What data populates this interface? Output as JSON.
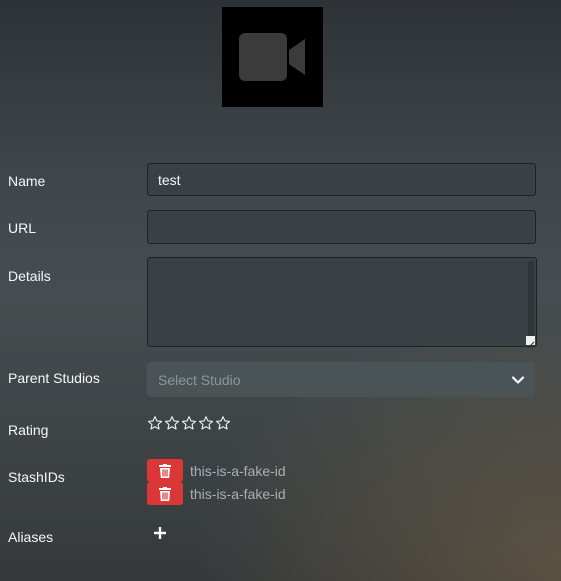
{
  "studio_image": {
    "icon": "video-camera-icon",
    "background": "#000000"
  },
  "form": {
    "name": {
      "label": "Name",
      "value": "test"
    },
    "url": {
      "label": "URL",
      "value": ""
    },
    "details": {
      "label": "Details",
      "value": ""
    },
    "parent_studios": {
      "label": "Parent Studios",
      "placeholder": "Select Studio",
      "icon": "chevron-down-icon"
    },
    "rating": {
      "label": "Rating",
      "value": 0,
      "max": 5,
      "icon": "star-outline-icon"
    },
    "stash_ids": {
      "label": "StashIDs",
      "items": [
        "this-is-a-fake-id",
        "this-is-a-fake-id"
      ],
      "delete_icon": "trash-icon",
      "delete_color": "#db3737"
    },
    "aliases": {
      "label": "Aliases",
      "add_icon": "plus-icon"
    }
  }
}
